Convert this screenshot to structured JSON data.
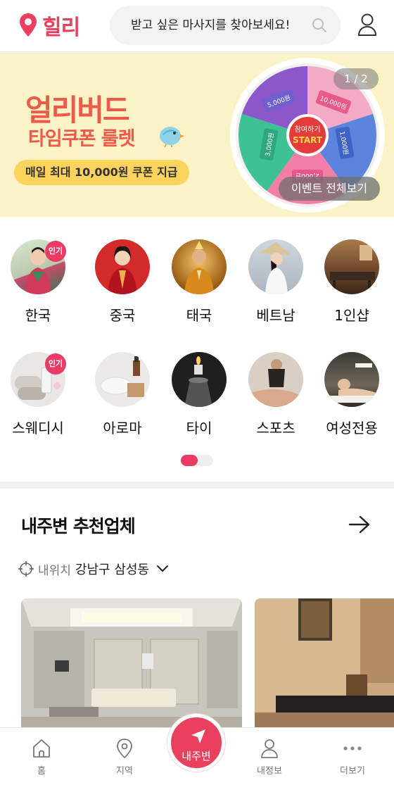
{
  "header": {
    "logo_text": "힐리",
    "search_placeholder": "받고 싶은 마사지를 찾아보세요!"
  },
  "banner": {
    "title": "얼리버드",
    "subtitle": "타임쿠폰 룰렛",
    "pill": "매일 최대 10,000원 쿠폰 지급",
    "page_indicator": "1 / 2",
    "events_button": "이벤트 전체보기",
    "roulette": {
      "center_line1": "참여하기",
      "center_line2": "START",
      "coupons": [
        "5,000원",
        "10,000원",
        "1,000원",
        "2,000원",
        "3,000원"
      ],
      "coupon_word": "쿠폰"
    }
  },
  "categories": {
    "items": [
      {
        "label": "한국",
        "badge": "인기"
      },
      {
        "label": "중국",
        "badge": ""
      },
      {
        "label": "태국",
        "badge": ""
      },
      {
        "label": "베트남",
        "badge": ""
      },
      {
        "label": "1인샵",
        "badge": ""
      },
      {
        "label": "스웨디시",
        "badge": "인기"
      },
      {
        "label": "아로마",
        "badge": ""
      },
      {
        "label": "타이",
        "badge": ""
      },
      {
        "label": "스포츠",
        "badge": ""
      },
      {
        "label": "여성전용",
        "badge": ""
      }
    ],
    "pager": {
      "pages": 2,
      "current": 1
    }
  },
  "recommend": {
    "title": "내주변 추천업체",
    "location_prefix": "내위치",
    "location_value": "강남구 삼성동"
  },
  "bottom_nav": {
    "home": "홈",
    "region": "지역",
    "nearby": "내주변",
    "my_info": "내정보",
    "more": "더보기"
  },
  "colors": {
    "brand": "#ea3f5d",
    "banner_bg": "#fbf2c5",
    "banner_text": "#ee5a4a",
    "pill_bg": "#fcd35c"
  }
}
